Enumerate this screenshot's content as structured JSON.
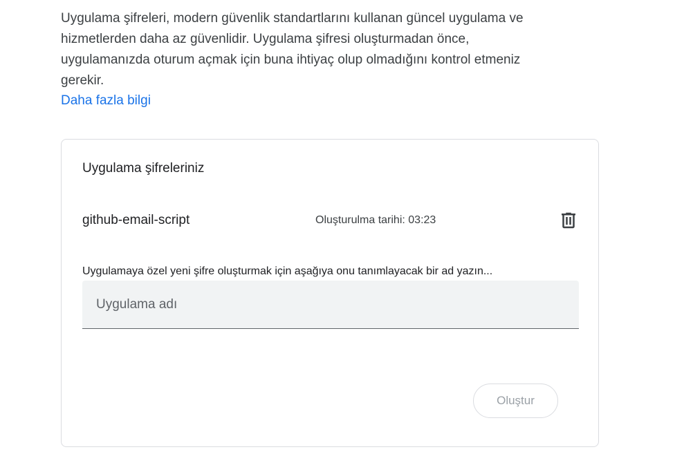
{
  "intro": {
    "text": "Uygulama şifreleri, modern güvenlik standartlarını kullanan güncel uygulama ve hizmetlerden daha az güvenlidir. Uygulama şifresi oluşturmadan önce, uygulamanızda oturum açmak için buna ihtiyaç olup olmadığını kontrol etmeniz gerekir.",
    "learn_more": "Daha fazla bilgi"
  },
  "card": {
    "title": "Uygulama şifreleriniz",
    "passwords": [
      {
        "name": "github-email-script",
        "created": "Oluşturulma tarihi: 03:23",
        "delete_icon": "trash-icon"
      }
    ],
    "helper_text": "Uygulamaya özel yeni şifre oluşturmak için aşağıya onu tanımlayacak bir ad yazın...",
    "input": {
      "placeholder": "Uygulama adı",
      "value": ""
    },
    "create_label": "Oluştur"
  },
  "colors": {
    "link": "#1a73e8",
    "disabled_text": "#9aa0a6",
    "input_bg": "#f1f3f4"
  }
}
